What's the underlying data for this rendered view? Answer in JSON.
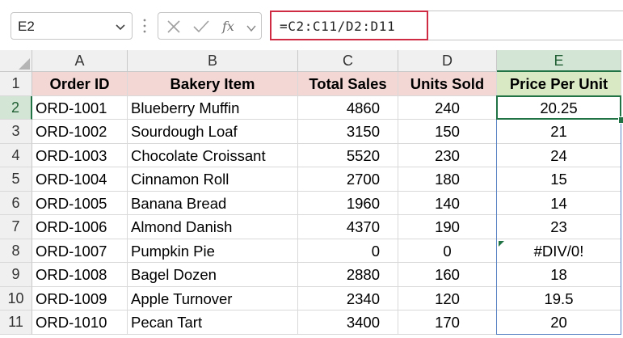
{
  "name_box": {
    "value": "E2"
  },
  "formula_bar": {
    "formula": "=C2:C11/D2:D11"
  },
  "colors": {
    "header_fill": "#f2d7d5",
    "price_header_fill": "#d9e9c4",
    "selection_border": "#5b84c4",
    "active_cell_border": "#217346",
    "formula_highlight": "#cf2c43"
  },
  "columns": [
    "A",
    "B",
    "C",
    "D",
    "E"
  ],
  "rows": [
    "1",
    "2",
    "3",
    "4",
    "5",
    "6",
    "7",
    "8",
    "9",
    "10",
    "11"
  ],
  "table": {
    "headers": [
      "Order ID",
      "Bakery Item",
      "Total Sales",
      "Units Sold",
      "Price Per Unit"
    ],
    "data": [
      [
        "ORD-1001",
        "Blueberry Muffin",
        "4860",
        "240",
        "20.25"
      ],
      [
        "ORD-1002",
        "Sourdough Loaf",
        "3150",
        "150",
        "21"
      ],
      [
        "ORD-1003",
        "Chocolate Croissant",
        "5520",
        "230",
        "24"
      ],
      [
        "ORD-1004",
        "Cinnamon Roll",
        "2700",
        "180",
        "15"
      ],
      [
        "ORD-1005",
        "Banana Bread",
        "1960",
        "140",
        "14"
      ],
      [
        "ORD-1006",
        "Almond Danish",
        "4370",
        "190",
        "23"
      ],
      [
        "ORD-1007",
        "Pumpkin Pie",
        "0",
        "0",
        "#DIV/0!"
      ],
      [
        "ORD-1008",
        "Bagel Dozen",
        "2880",
        "160",
        "18"
      ],
      [
        "ORD-1009",
        "Apple Turnover",
        "2340",
        "120",
        "19.5"
      ],
      [
        "ORD-1010",
        "Pecan Tart",
        "3400",
        "170",
        "20"
      ]
    ]
  }
}
